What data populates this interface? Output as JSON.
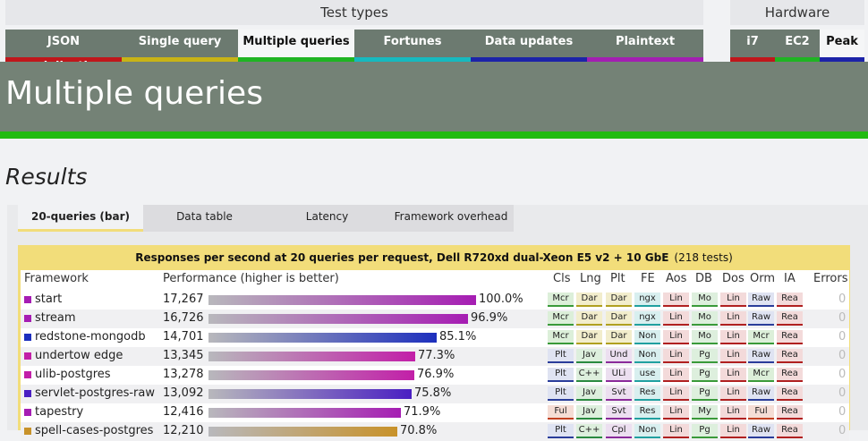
{
  "groups": {
    "test_types": "Test types",
    "hardware": "Hardware"
  },
  "test_tabs": [
    {
      "label": "JSON serialization",
      "color": "#c0171b"
    },
    {
      "label": "Single query",
      "color": "#c8b316"
    },
    {
      "label": "Multiple queries",
      "color": "#1fb423"
    },
    {
      "label": "Fortunes",
      "color": "#16b9bf"
    },
    {
      "label": "Data updates",
      "color": "#1c23a8"
    },
    {
      "label": "Plaintext",
      "color": "#a31fb2"
    }
  ],
  "hw_tabs": [
    {
      "label": "i7",
      "color": "#c0171b"
    },
    {
      "label": "EC2",
      "color": "#1fb423"
    },
    {
      "label": "Peak",
      "color": "#1c23a8"
    }
  ],
  "hero_title": "Multiple queries",
  "results_title": "Results",
  "sub_tabs": [
    "20-queries (bar)",
    "Data table",
    "Latency",
    "Framework overhead"
  ],
  "chart_title": "Responses per second at 20 queries per request, Dell R720xd dual-Xeon E5 v2 + 10 GbE",
  "test_count": "(218 tests)",
  "headers": {
    "framework": "Framework",
    "performance": "Performance (higher is better)",
    "cls": "Cls",
    "lng": "Lng",
    "plt": "Plt",
    "fe": "FE",
    "aos": "Aos",
    "db": "DB",
    "dos": "Dos",
    "orm": "Orm",
    "ia": "IA",
    "errors": "Errors"
  },
  "chart_data": {
    "type": "bar",
    "xlabel": "Performance (higher is better)",
    "rows": [
      {
        "name": "start",
        "value": 17267,
        "display": "17,267",
        "pct": "100.0%",
        "color": "#a61db3",
        "tags": [
          "Mcr",
          "Dar",
          "Dar",
          "ngx",
          "Lin",
          "Mo",
          "Lin",
          "Raw",
          "Rea"
        ],
        "errors": "0"
      },
      {
        "name": "stream",
        "value": 16726,
        "display": "16,726",
        "pct": "96.9%",
        "color": "#a61db3",
        "tags": [
          "Mcr",
          "Dar",
          "Dar",
          "ngx",
          "Lin",
          "Mo",
          "Lin",
          "Raw",
          "Rea"
        ],
        "errors": "0"
      },
      {
        "name": "redstone-mongodb",
        "value": 14701,
        "display": "14,701",
        "pct": "85.1%",
        "color": "#1d2fbd",
        "tags": [
          "Mcr",
          "Dar",
          "Dar",
          "Non",
          "Lin",
          "Mo",
          "Lin",
          "Mcr",
          "Rea"
        ],
        "errors": "0"
      },
      {
        "name": "undertow edge",
        "value": 13345,
        "display": "13,345",
        "pct": "77.3%",
        "color": "#c21fa8",
        "tags": [
          "Plt",
          "Jav",
          "Und",
          "Non",
          "Lin",
          "Pg",
          "Lin",
          "Raw",
          "Rea"
        ],
        "errors": "0"
      },
      {
        "name": "ulib-postgres",
        "value": 13278,
        "display": "13,278",
        "pct": "76.9%",
        "color": "#c21fa8",
        "tags": [
          "Plt",
          "C++",
          "ULi",
          "use",
          "Lin",
          "Pg",
          "Lin",
          "Mcr",
          "Rea"
        ],
        "errors": "0"
      },
      {
        "name": "servlet-postgres-raw",
        "value": 13092,
        "display": "13,092",
        "pct": "75.8%",
        "color": "#4a1fc2",
        "tags": [
          "Plt",
          "Jav",
          "Svt",
          "Res",
          "Lin",
          "Pg",
          "Lin",
          "Raw",
          "Rea"
        ],
        "errors": "0"
      },
      {
        "name": "tapestry",
        "value": 12416,
        "display": "12,416",
        "pct": "71.9%",
        "color": "#a61db3",
        "tags": [
          "Ful",
          "Jav",
          "Svt",
          "Res",
          "Lin",
          "My",
          "Lin",
          "Ful",
          "Rea"
        ],
        "errors": "0"
      },
      {
        "name": "spell-cases-postgres",
        "value": 12210,
        "display": "12,210",
        "pct": "70.8%",
        "color": "#c8922a",
        "tags": [
          "Plt",
          "C++",
          "Cpl",
          "Non",
          "Lin",
          "Pg",
          "Lin",
          "Raw",
          "Rea"
        ],
        "errors": "0"
      }
    ]
  },
  "tag_colors": {
    "Mcr": "#3a9a3a",
    "Plt": "#2a3d9a",
    "Ful": "#c24020",
    "Dar": "#b0a020",
    "Jav": "#2a8a40",
    "C++": "#2a8a40",
    "Und": "#8a2a9a",
    "ULi": "#8a2a9a",
    "Svt": "#8a2a9a",
    "Cpl": "#8a2a9a",
    "ngx": "#20a0a0",
    "Non": "#20a0a0",
    "use": "#20a0a0",
    "Res": "#20a0a0",
    "Lin": "#b02020",
    "Mo": "#3a9a3a",
    "Pg": "#3a9a3a",
    "My": "#3a9a3a",
    "Raw": "#2a3d9a",
    "Rea": "#b02020"
  },
  "tag_bg": {
    "Mcr": "#dcefd9",
    "Plt": "#dfe3f2",
    "Ful": "#f5ddd5",
    "Dar": "#f2edcc",
    "Jav": "#ddefdd",
    "C++": "#ddefdd",
    "Und": "#ecdff0",
    "ULi": "#ecdff0",
    "Svt": "#ecdff0",
    "Cpl": "#ecdff0",
    "ngx": "#d8efef",
    "Non": "#d8efef",
    "use": "#d8efef",
    "Res": "#d8efef",
    "Lin": "#f3dada",
    "Mo": "#ddefdd",
    "Pg": "#ddefdd",
    "My": "#ddefdd",
    "Raw": "#dfe3f2",
    "Rea": "#f3dada"
  }
}
